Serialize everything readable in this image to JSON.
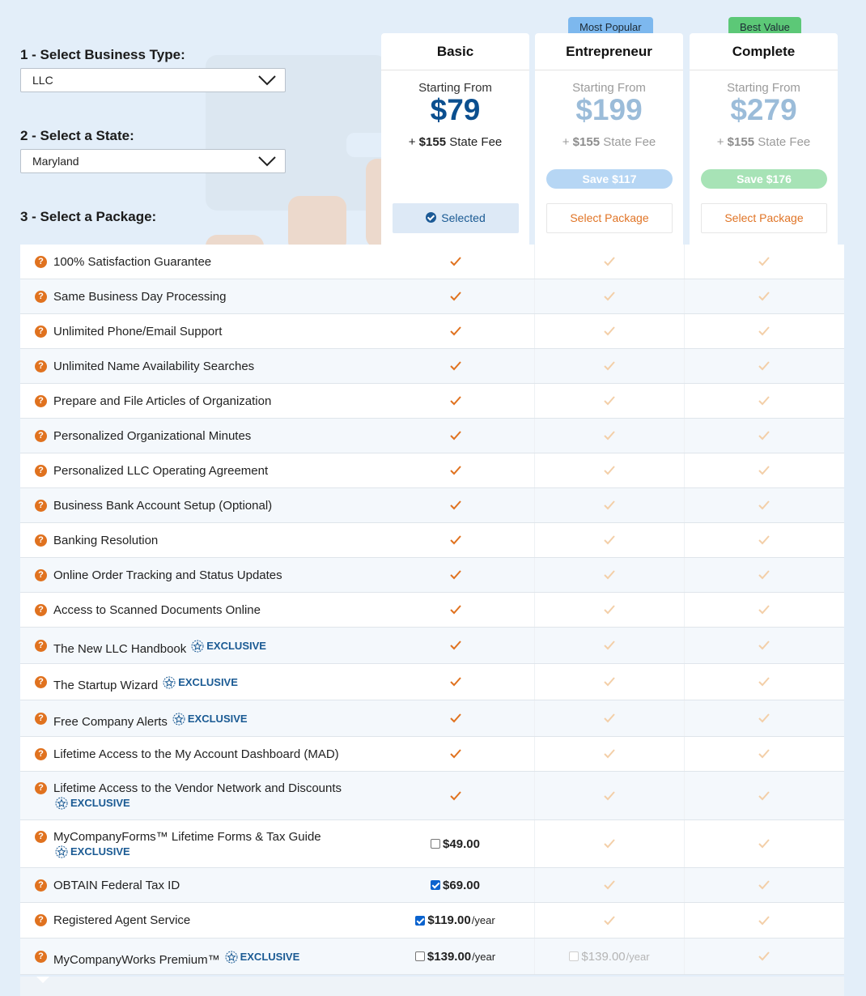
{
  "step1": {
    "label": "1 - Select Business Type:",
    "value": "LLC"
  },
  "step2": {
    "label": "2 - Select a State:",
    "value": "Maryland"
  },
  "step3": {
    "label": "3 - Select a Package:"
  },
  "plans": [
    {
      "name": "Basic",
      "starting": "Starting From",
      "price": "$79",
      "fee_amount": "$155",
      "fee_label": "State Fee",
      "button": "Selected",
      "save": ""
    },
    {
      "name": "Entrepreneur",
      "starting": "Starting From",
      "price": "$199",
      "fee_amount": "$155",
      "fee_label": "State Fee",
      "button": "Select Package",
      "save": "Save $117",
      "badge": "Most Popular"
    },
    {
      "name": "Complete",
      "starting": "Starting From",
      "price": "$279",
      "fee_amount": "$155",
      "fee_label": "State Fee",
      "button": "Select Package",
      "save": "Save $176",
      "badge": "Best Value"
    }
  ],
  "fee_plus": "+",
  "exclusive_label": "EXCLUSIVE",
  "help_icon": "question-icon",
  "colors": {
    "accent_orange": "#e0721f",
    "navy": "#0b4f8f",
    "popular_badge": "#7db8ee",
    "best_badge": "#5cc877",
    "save_blue": "#b6d6f4",
    "save_green": "#a7e3b6"
  },
  "features": [
    {
      "name": "100% Satisfaction Guarantee",
      "exclusive": false,
      "basic": "check",
      "entrepreneur": "check",
      "complete": "check"
    },
    {
      "name": "Same Business Day Processing",
      "exclusive": false,
      "basic": "check",
      "entrepreneur": "check",
      "complete": "check"
    },
    {
      "name": "Unlimited Phone/Email Support",
      "exclusive": false,
      "basic": "check",
      "entrepreneur": "check",
      "complete": "check"
    },
    {
      "name": "Unlimited Name Availability Searches",
      "exclusive": false,
      "basic": "check",
      "entrepreneur": "check",
      "complete": "check"
    },
    {
      "name": "Prepare and File Articles of Organization",
      "exclusive": false,
      "basic": "check",
      "entrepreneur": "check",
      "complete": "check"
    },
    {
      "name": "Personalized Organizational Minutes",
      "exclusive": false,
      "basic": "check",
      "entrepreneur": "check",
      "complete": "check"
    },
    {
      "name": "Personalized LLC Operating Agreement",
      "exclusive": false,
      "basic": "check",
      "entrepreneur": "check",
      "complete": "check"
    },
    {
      "name": "Business Bank Account Setup (Optional)",
      "exclusive": false,
      "basic": "check",
      "entrepreneur": "check",
      "complete": "check"
    },
    {
      "name": "Banking Resolution",
      "exclusive": false,
      "basic": "check",
      "entrepreneur": "check",
      "complete": "check"
    },
    {
      "name": "Online Order Tracking and Status Updates",
      "exclusive": false,
      "basic": "check",
      "entrepreneur": "check",
      "complete": "check"
    },
    {
      "name": "Access to Scanned Documents Online",
      "exclusive": false,
      "basic": "check",
      "entrepreneur": "check",
      "complete": "check"
    },
    {
      "name": "The New LLC Handbook",
      "exclusive": true,
      "basic": "check",
      "entrepreneur": "check",
      "complete": "check"
    },
    {
      "name": "The Startup Wizard",
      "exclusive": true,
      "basic": "check",
      "entrepreneur": "check",
      "complete": "check"
    },
    {
      "name": "Free Company Alerts",
      "exclusive": true,
      "basic": "check",
      "entrepreneur": "check",
      "complete": "check"
    },
    {
      "name": "Lifetime Access to the My Account Dashboard (MAD)",
      "exclusive": false,
      "basic": "check",
      "entrepreneur": "check",
      "complete": "check"
    },
    {
      "name": "Lifetime Access to the Vendor Network and Discounts",
      "exclusive": true,
      "wrap": true,
      "basic": "check",
      "entrepreneur": "check",
      "complete": "check"
    },
    {
      "name": "MyCompanyForms™ Lifetime Forms & Tax Guide",
      "exclusive": true,
      "wrap": true,
      "basic": {
        "price": "$49.00",
        "per": "",
        "checked": false
      },
      "entrepreneur": "check",
      "complete": "check"
    },
    {
      "name": "OBTAIN Federal Tax ID",
      "exclusive": false,
      "basic": {
        "price": "$69.00",
        "per": "",
        "checked": true
      },
      "entrepreneur": "check",
      "complete": "check"
    },
    {
      "name": "Registered Agent Service",
      "exclusive": false,
      "basic": {
        "price": "$119.00",
        "per": "/year",
        "checked": true
      },
      "entrepreneur": "check",
      "complete": "check"
    },
    {
      "name": "MyCompanyWorks Premium™",
      "exclusive": true,
      "basic": {
        "price": "$139.00",
        "per": "/year",
        "checked": false
      },
      "entrepreneur": {
        "price": "$139.00",
        "per": "/year",
        "checked": false,
        "disabled": true
      },
      "complete": "check"
    }
  ]
}
